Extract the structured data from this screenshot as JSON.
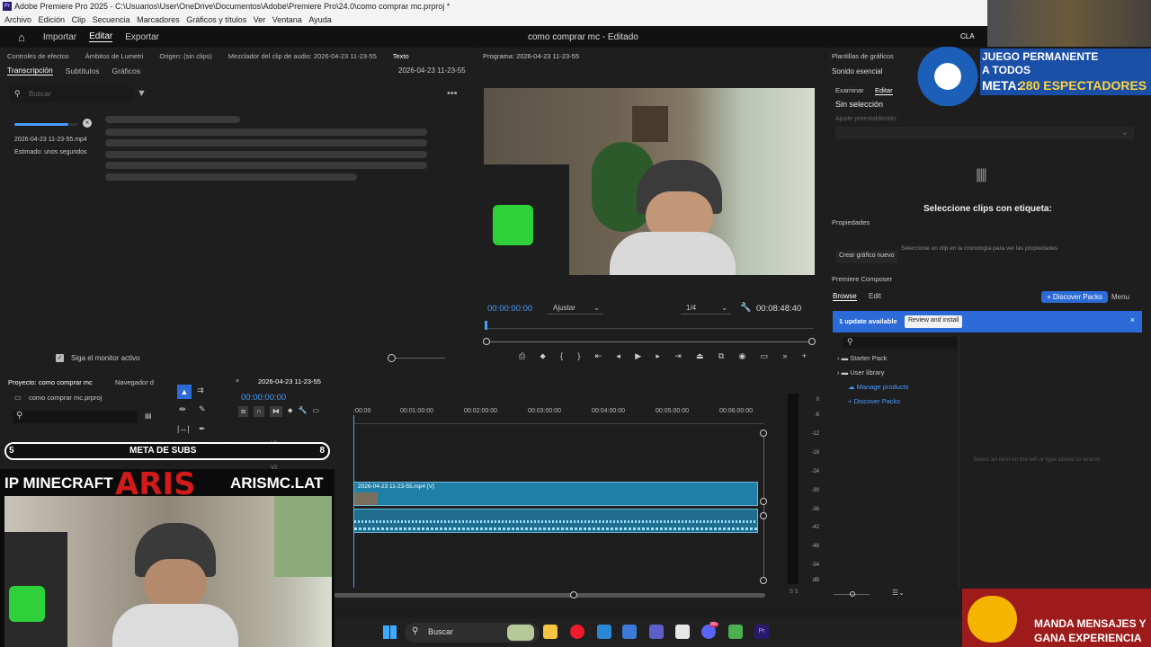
{
  "window": {
    "title": "Adobe Premiere Pro 2025 - C:\\Usuarios\\User\\OneDrive\\Documentos\\Adobe\\Premiere Pro\\24.0\\como comprar mc.prproj *"
  },
  "menu": [
    "Archivo",
    "Edición",
    "Clip",
    "Secuencia",
    "Marcadores",
    "Gráficos y títulos",
    "Ver",
    "Ventana",
    "Ayuda"
  ],
  "appbar": {
    "import": "Importar",
    "edit": "Editar",
    "export": "Exportar",
    "doc_title": "como comprar mc - Editado"
  },
  "source_panel": {
    "tabs": [
      "Controles de efectos",
      "Ámbitos de Lumetri",
      "Origen: (sin clips)",
      "Mezclador del clip de audio: 2026-04-23 11-23-55",
      "Texto"
    ],
    "subtabs": [
      "Transcripción",
      "Subtítulos",
      "Gráficos"
    ],
    "timestamp": "2026-04-23 11-23-55",
    "search_placeholder": "Buscar",
    "file": "2026-04-23 11-23-55.mp4",
    "estimate": "Estimado: unos segundos",
    "follow_monitor": "Siga el monitor activo"
  },
  "program": {
    "title": "Programa: 2026-04-23 11-23-55",
    "timecode": "00:00:00:00",
    "fit": "Ajustar",
    "resolution": "1/4",
    "duration": "00:08:48:40"
  },
  "right_panel": {
    "header": "Plantillas de gráficos",
    "essential_sound": "Sonido esencial",
    "tabs": [
      "Examinar",
      "Editar"
    ],
    "no_selection": "Sin selección",
    "preset_label": "Ajuste preestablecido:",
    "select_clips": "Seleccione clips con etiqueta:",
    "properties": "Propiedades",
    "properties_hint": "Seleccione un clip en la cronología para ver las propiedades.",
    "new_graphic": "Crear gráfico nuevo"
  },
  "composer": {
    "title": "Premiere Composer",
    "tabs": [
      "Browse",
      "Edit"
    ],
    "discover_btn": "+ Discover Packs",
    "menu": "Menu",
    "update_text": "1 update available",
    "review_btn": "Review and install",
    "tree": [
      "Starter Pack",
      "User library",
      "Manage products",
      "Discover Packs"
    ],
    "placeholder": "Select an item on the left or type above to search."
  },
  "project": {
    "tab": "Proyecto: como comprar mc",
    "nav_tab": "Navegador d",
    "file": "como comprar mc.prproj"
  },
  "timeline": {
    "sequence": "2026-04-23 11-23-55",
    "timecode": "00:00:00:00",
    "ticks": [
      ":00:00",
      "00:01:00:00",
      "00:02:00:00",
      "00:03:00:00",
      "00:04:00:00",
      "00:05:00:00",
      "00:06:00:00"
    ],
    "clip": "2026-04-23 11-23-55.mp4 [V]",
    "tracks": [
      "V3",
      "V2"
    ]
  },
  "meter": {
    "labels": [
      "0",
      "-6",
      "-12",
      "-18",
      "-24",
      "-30",
      "-36",
      "-42",
      "-48",
      "-54",
      "dB"
    ],
    "footer": "S S"
  },
  "stream_overlay": {
    "goal_label": "META DE SUBS",
    "goal_current": "5",
    "goal_target": "8",
    "ip_label": "IP MINECRAFT",
    "server_brand": "ARIS",
    "server_domain": "ARISMC.LAT",
    "promo_line1": "JUEGO PERMANENTE",
    "promo_line2": "A TODOS",
    "promo_meta_label": "META:",
    "promo_meta_value": "280 ESPECTADORES",
    "clan": "CLA",
    "bottom_line1": "MANDA MENSAJES Y",
    "bottom_line2": "GANA EXPERIENCIA"
  },
  "taskbar": {
    "search": "Buscar",
    "badge": "99+"
  }
}
